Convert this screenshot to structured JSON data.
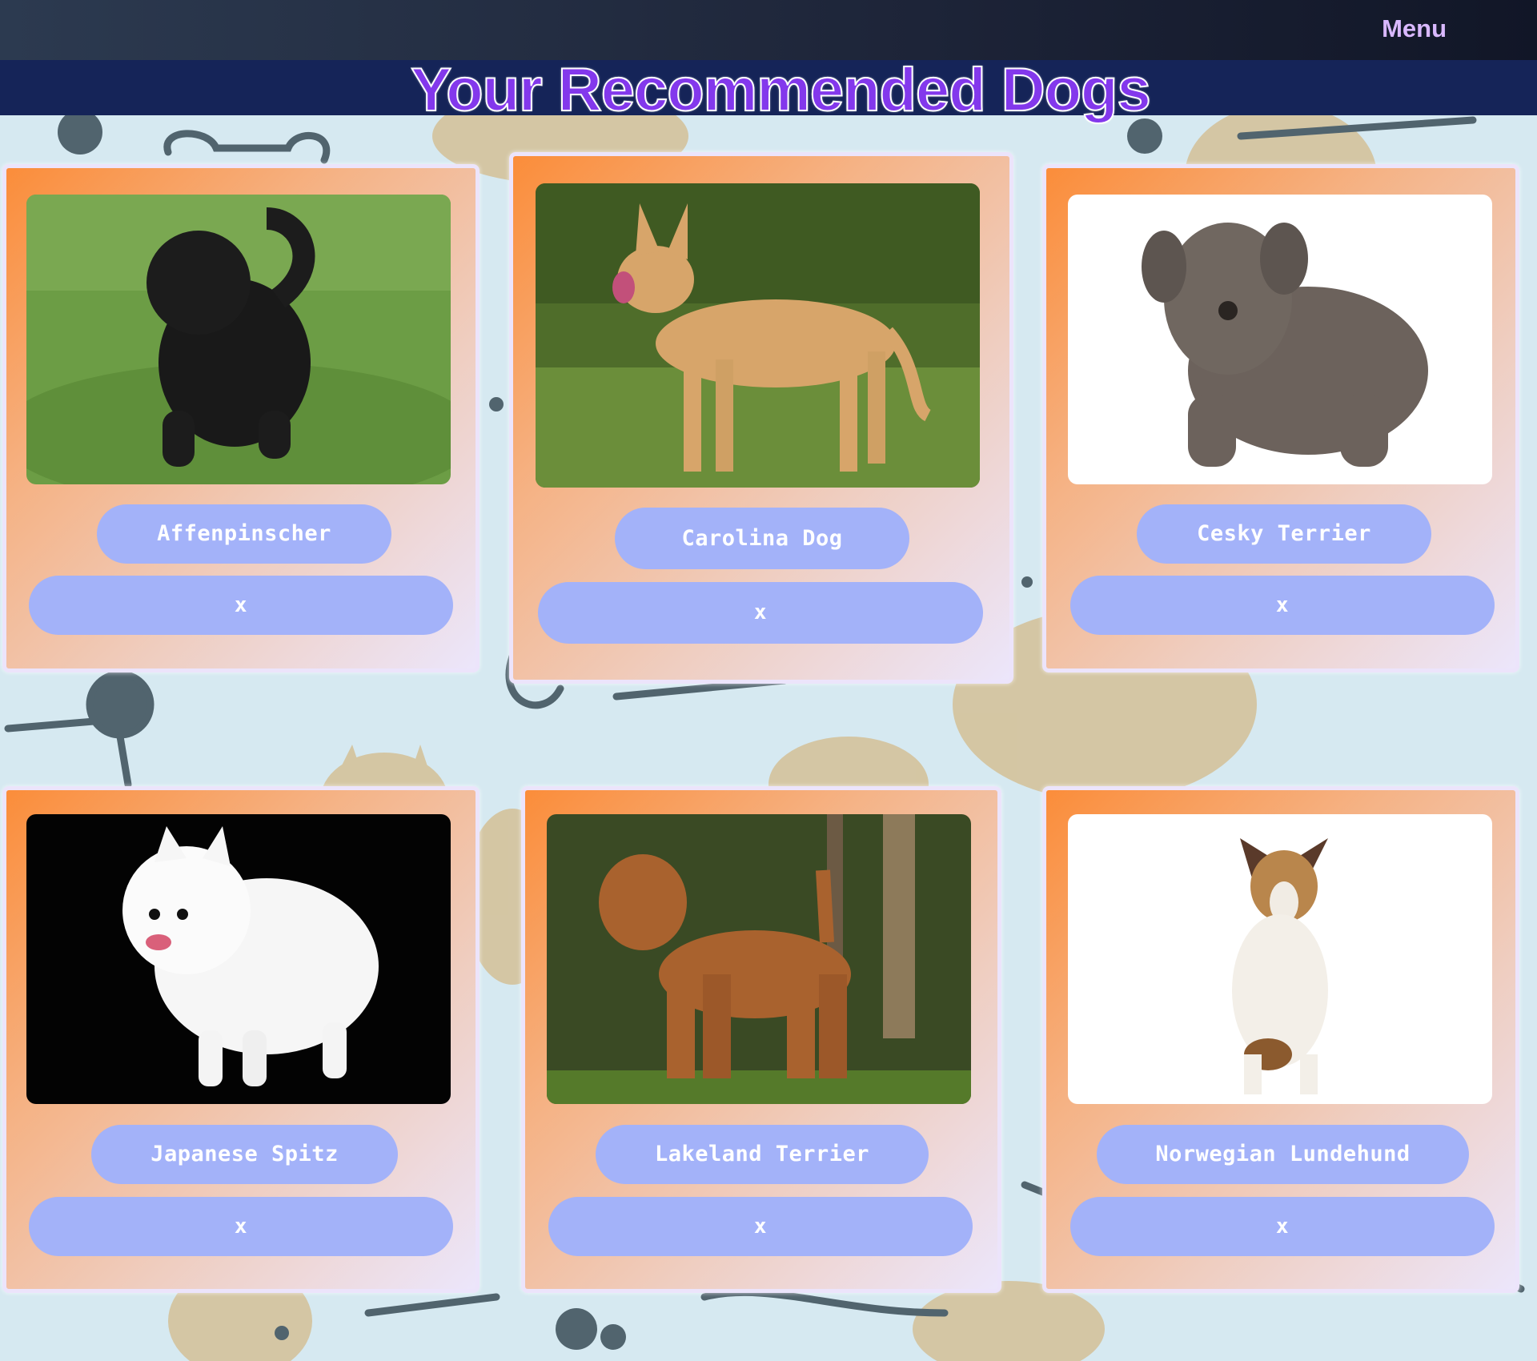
{
  "nav": {
    "menu_label": "Menu"
  },
  "header": {
    "title": "Your Recommended Dogs"
  },
  "colors": {
    "accent": "#8338ec",
    "pill": "#a3b2f9",
    "card_start": "#fb8d3a",
    "title_bar": "#152458"
  },
  "dogs": [
    {
      "name": "Affenpinscher",
      "remove_label": "x",
      "photo_icon": "affenpinscher-photo"
    },
    {
      "name": "Carolina Dog",
      "remove_label": "x",
      "photo_icon": "carolina-dog-photo"
    },
    {
      "name": "Cesky Terrier",
      "remove_label": "x",
      "photo_icon": "cesky-terrier-photo"
    },
    {
      "name": "Japanese Spitz",
      "remove_label": "x",
      "photo_icon": "japanese-spitz-photo"
    },
    {
      "name": "Lakeland Terrier",
      "remove_label": "x",
      "photo_icon": "lakeland-terrier-photo"
    },
    {
      "name": "Norwegian Lundehund",
      "remove_label": "x",
      "photo_icon": "norwegian-lundehund-photo"
    }
  ]
}
